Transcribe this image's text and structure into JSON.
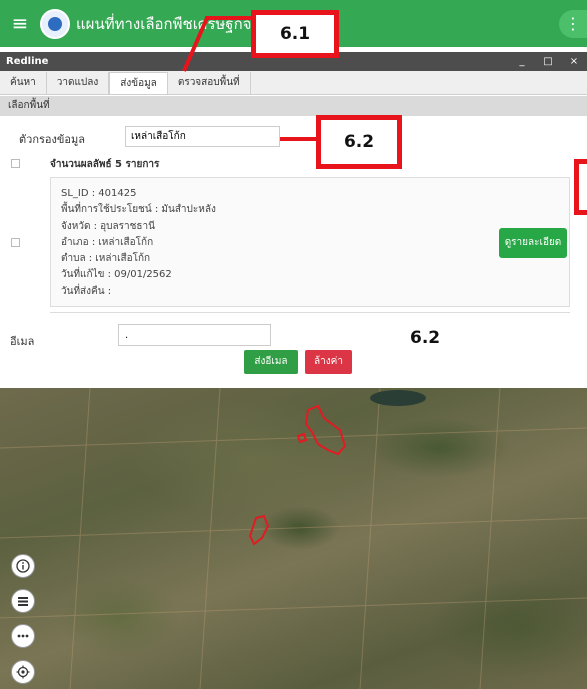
{
  "app": {
    "title": "แผนที่ทางเลือกพืชเศรษฐกิจ",
    "menu_icon": "hamburger-menu-icon",
    "more_icon": "vertical-dots-icon",
    "accent_color": "#34a853"
  },
  "window": {
    "title": "Redline",
    "minimize": "_",
    "maximize": "□",
    "close": "×"
  },
  "tabs": [
    {
      "label": "ค้นหา"
    },
    {
      "label": "วาดแปลง"
    },
    {
      "label": "ส่งข้อมูล",
      "active": true
    },
    {
      "label": "ตรวจสอบพื้นที่"
    }
  ],
  "section": {
    "title": "เลือกพื้นที่"
  },
  "filter": {
    "label": "ตัวกรองข้อมูล",
    "value": "เหล่าเสือโก้ก"
  },
  "results": {
    "count_label": "จำนวนผลลัพธ์ 5 รายการ",
    "items": [
      {
        "lines": [
          "SL_ID : 401425",
          "พื้นที่การใช้ประโยชน์ : มันสำปะหลัง",
          "จังหวัด : อุบลราชธานี",
          "อำเภอ : เหล่าเสือโก้ก",
          "ตำบล : เหล่าเสือโก้ก",
          "วันที่แก้ไข : 09/01/2562",
          "วันที่ส่งคืน :"
        ],
        "detail_button": "ดูรายละเอียด"
      }
    ]
  },
  "email": {
    "label": "อีเมล",
    "value": "."
  },
  "buttons": {
    "send": "ส่งอีเมล",
    "clear": "ล้างค่า",
    "send_color": "#2f9e44",
    "clear_color": "#dc3545"
  },
  "callouts": {
    "tab_callout": "6.1",
    "filter_callout": "6.2",
    "email_callout": "6.2",
    "callout_color": "#e8141b"
  },
  "map_tools": [
    {
      "icon": "info-icon"
    },
    {
      "icon": "layer-list-icon"
    },
    {
      "icon": "more-options-icon"
    },
    {
      "icon": "locate-icon"
    }
  ]
}
